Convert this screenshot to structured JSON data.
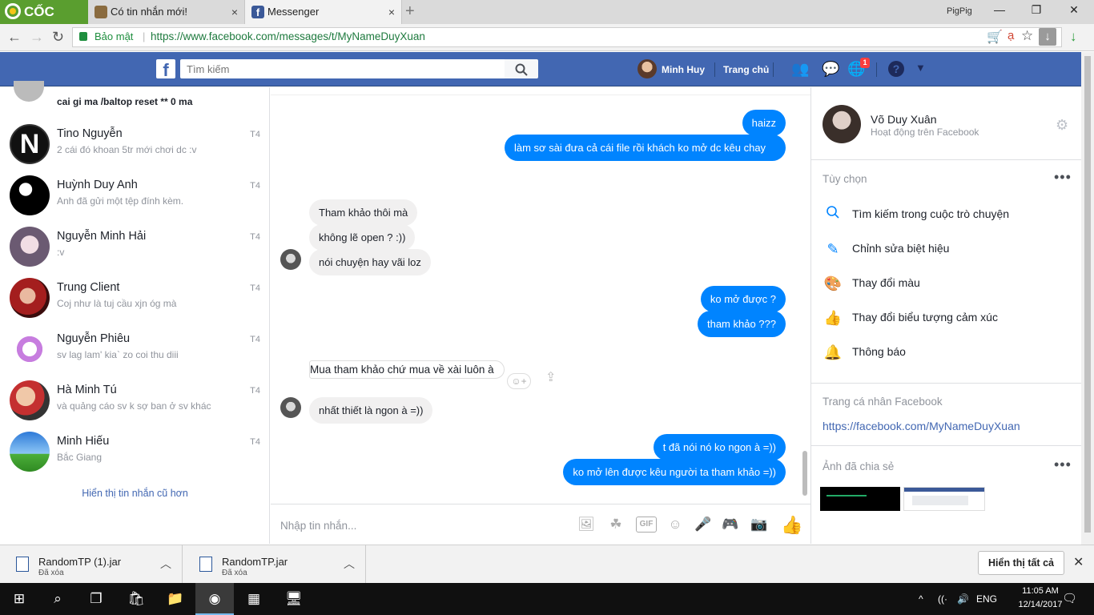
{
  "browser": {
    "brand": "CỐC CỐC",
    "tabs": [
      {
        "title": "Có tin nhắn mới!",
        "close": "×"
      },
      {
        "title": "Messenger",
        "close": "×"
      }
    ],
    "new_tab": "+",
    "profile": "PigPig",
    "window_controls": {
      "minimize": "—",
      "maximize": "❐",
      "close": "✕"
    },
    "nav": {
      "back": "←",
      "forward": "→",
      "reload": "↻"
    },
    "secure_label": "Bảo mật",
    "url": "https://www.facebook.com/messages/t/MyNameDuyXuan",
    "icons": {
      "cart": "cart-icon",
      "rss": "ạ",
      "star": "☆",
      "download_box": "↓",
      "download": "↓"
    }
  },
  "facebook": {
    "logo": "f",
    "search_placeholder": "Tìm kiếm",
    "user_name": "Minh Huy",
    "home": "Trang chủ",
    "notification_count": "1",
    "help": "?",
    "caret": "▼"
  },
  "conversations": {
    "top_partial": {
      "preview": "cai gi ma /baltop reset ** 0 ma"
    },
    "items": [
      {
        "name": "Tino Nguyễn",
        "preview": "2 cái đó khoan 5tr mới chơi dc :v",
        "time": "T4"
      },
      {
        "name": "Huỳnh Duy Anh",
        "preview": "Anh đã gửi một tệp đính kèm.",
        "time": "T4"
      },
      {
        "name": "Nguyễn Minh Hải",
        "preview": ":v",
        "time": "T4"
      },
      {
        "name": "Trung Client",
        "preview": "Coj như là tuj cầu xjn óg mà",
        "time": "T4"
      },
      {
        "name": "Nguyễn Phiêu",
        "preview": "sv lag lam' kia` zo coi thu diii",
        "time": "T4"
      },
      {
        "name": "Hà Minh Tú",
        "preview": "và quảng cáo sv k sợ ban ở sv khác",
        "time": "T4"
      },
      {
        "name": "Minh Hiếu",
        "preview": "Bắc Giang",
        "time": "T4"
      }
    ],
    "older_link": "Hiển thị tin nhắn cũ hơn"
  },
  "chat": {
    "messages": [
      {
        "from": "me",
        "text": "haizz"
      },
      {
        "from": "me",
        "text": "làm sơ sài đưa cả cái file rồi khách ko mở dc kêu chay"
      },
      {
        "from": "them",
        "text": "Tham khảo thôi mà"
      },
      {
        "from": "them",
        "text": "không lẽ open ? :))"
      },
      {
        "from": "them",
        "text": "nói chuyện hay vãi loz"
      },
      {
        "from": "me",
        "text": "ko mở được ?"
      },
      {
        "from": "me",
        "text": "tham khảo ???"
      },
      {
        "from": "them",
        "text": "Mua tham khảo chứ mua về xài luôn à"
      },
      {
        "from": "them",
        "text": "nhất thiết là ngon à =))"
      },
      {
        "from": "me",
        "text": "t đã nói nó ko ngon à =))"
      },
      {
        "from": "me",
        "text": "ko mở lên được kêu người ta tham khảo =))"
      }
    ],
    "composer_placeholder": "Nhập tin nhắn...",
    "gif_label": "GIF"
  },
  "info_panel": {
    "name": "Võ Duy Xuân",
    "status": "Hoạt động trên Facebook",
    "options_header": "Tùy chọn",
    "more": "•••",
    "options": [
      {
        "icon": "search-icon",
        "label": "Tìm kiếm trong cuộc trò chuyện"
      },
      {
        "icon": "pencil-icon",
        "label": "Chỉnh sửa biệt hiệu"
      },
      {
        "icon": "palette-icon",
        "label": "Thay đổi màu"
      },
      {
        "icon": "thumbs-up-icon",
        "label": "Thay đổi biểu tượng cảm xúc"
      },
      {
        "icon": "bell-icon",
        "label": "Thông báo"
      }
    ],
    "profile_header": "Trang cá nhân Facebook",
    "profile_link": "https://facebook.com/MyNameDuyXuan",
    "shared_header": "Ảnh đã chia sẻ"
  },
  "downloads": {
    "items": [
      {
        "name": "RandomTP (1).jar",
        "status": "Đã xóa"
      },
      {
        "name": "RandomTP.jar",
        "status": "Đã xóa"
      }
    ],
    "show_all": "Hiển thị tất cả",
    "close": "✕"
  },
  "taskbar": {
    "language": "ENG",
    "time": "11:05 AM",
    "date": "12/14/2017"
  },
  "colors": {
    "facebook_blue": "#4267b2",
    "messenger_blue": "#0084ff",
    "coccoc_green": "#5a9e2f"
  }
}
